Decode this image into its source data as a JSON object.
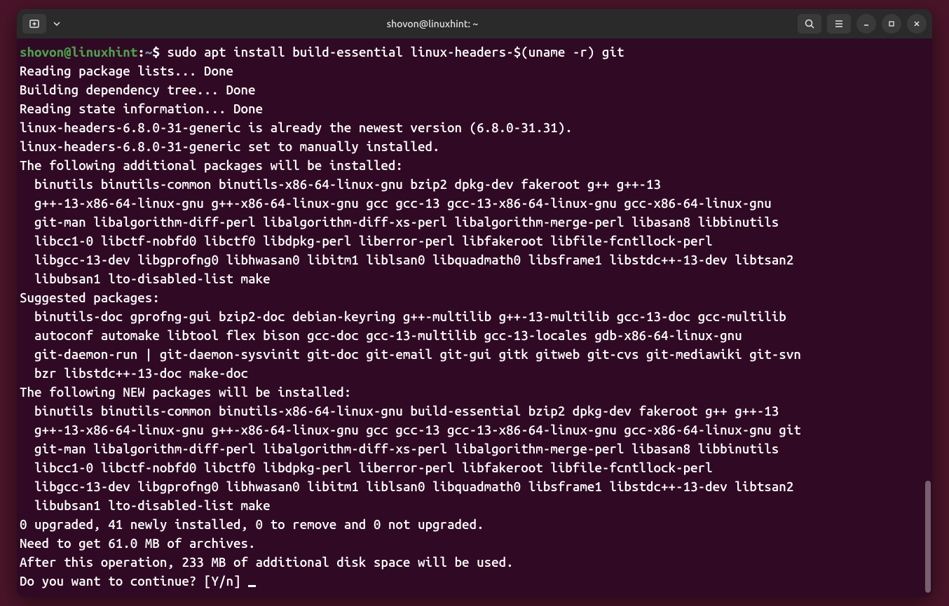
{
  "titlebar": {
    "title": "shovon@linuxhint: ~"
  },
  "prompt": {
    "user_host": "shovon@linuxhint",
    "sep1": ":",
    "path": "~",
    "sep2": "$"
  },
  "command": " sudo apt install build-essential linux-headers-$(uname -r) git",
  "output_lines": [
    "Reading package lists... Done",
    "Building dependency tree... Done",
    "Reading state information... Done",
    "linux-headers-6.8.0-31-generic is already the newest version (6.8.0-31.31).",
    "linux-headers-6.8.0-31-generic set to manually installed.",
    "The following additional packages will be installed:",
    "  binutils binutils-common binutils-x86-64-linux-gnu bzip2 dpkg-dev fakeroot g++ g++-13",
    "  g++-13-x86-64-linux-gnu g++-x86-64-linux-gnu gcc gcc-13 gcc-13-x86-64-linux-gnu gcc-x86-64-linux-gnu",
    "  git-man libalgorithm-diff-perl libalgorithm-diff-xs-perl libalgorithm-merge-perl libasan8 libbinutils",
    "  libcc1-0 libctf-nobfd0 libctf0 libdpkg-perl liberror-perl libfakeroot libfile-fcntllock-perl",
    "  libgcc-13-dev libgprofng0 libhwasan0 libitm1 liblsan0 libquadmath0 libsframe1 libstdc++-13-dev libtsan2",
    "  libubsan1 lto-disabled-list make",
    "Suggested packages:",
    "  binutils-doc gprofng-gui bzip2-doc debian-keyring g++-multilib g++-13-multilib gcc-13-doc gcc-multilib",
    "  autoconf automake libtool flex bison gcc-doc gcc-13-multilib gcc-13-locales gdb-x86-64-linux-gnu",
    "  git-daemon-run | git-daemon-sysvinit git-doc git-email git-gui gitk gitweb git-cvs git-mediawiki git-svn",
    "  bzr libstdc++-13-doc make-doc",
    "The following NEW packages will be installed:",
    "  binutils binutils-common binutils-x86-64-linux-gnu build-essential bzip2 dpkg-dev fakeroot g++ g++-13",
    "  g++-13-x86-64-linux-gnu g++-x86-64-linux-gnu gcc gcc-13 gcc-13-x86-64-linux-gnu gcc-x86-64-linux-gnu git",
    "  git-man libalgorithm-diff-perl libalgorithm-diff-xs-perl libalgorithm-merge-perl libasan8 libbinutils",
    "  libcc1-0 libctf-nobfd0 libctf0 libdpkg-perl liberror-perl libfakeroot libfile-fcntllock-perl",
    "  libgcc-13-dev libgprofng0 libhwasan0 libitm1 liblsan0 libquadmath0 libsframe1 libstdc++-13-dev libtsan2",
    "  libubsan1 lto-disabled-list make",
    "0 upgraded, 41 newly installed, 0 to remove and 0 not upgraded.",
    "Need to get 61.0 MB of archives.",
    "After this operation, 233 MB of additional disk space will be used.",
    "Do you want to continue? [Y/n] "
  ]
}
